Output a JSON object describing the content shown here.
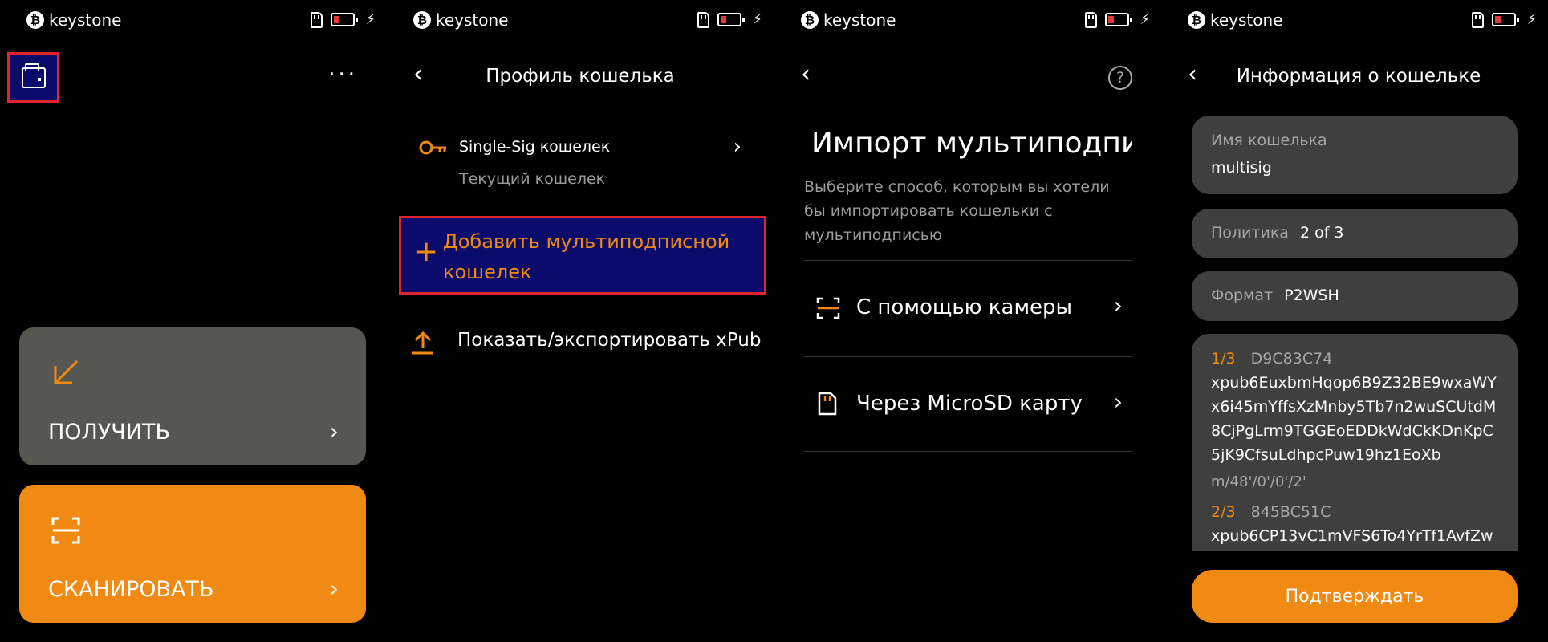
{
  "status_bar": {
    "brand": "keystone",
    "btc_symbol": "₿"
  },
  "screen1": {
    "receive_label": "ПОЛУЧИТЬ",
    "scan_label": "СКАНИРОВАТЬ",
    "chevron": "›",
    "more": "···",
    "colors": {
      "receive_card": "#565752",
      "scan_card": "#f18a12"
    }
  },
  "screen2": {
    "title": "Профиль кошелька",
    "single_sig_title": "Single-Sig кошелек",
    "single_sig_sub": "Текущий кошелек",
    "add_multisig": "Добавить мультиподписной кошелек",
    "plus": "+",
    "export_xpub": "Показать/экспортировать xPub"
  },
  "screen3": {
    "title": "Импорт мультиподпис",
    "description": "Выберите способ, которым вы хотели бы импортировать кошельки с мультиподписью",
    "help": "?",
    "options": [
      {
        "label": "С помощью камеры",
        "icon": "scan-icon"
      },
      {
        "label": "Через MicroSD карту",
        "icon": "microsd-icon"
      }
    ]
  },
  "screen4": {
    "title": "Информация о кошельке",
    "name_label": "Имя кошелька",
    "name_value": "multisig",
    "policy_label": "Политика",
    "policy_value": "2 of 3",
    "format_label": "Формат",
    "format_value": "P2WSH",
    "keys": [
      {
        "index": "1/3",
        "fingerprint": "D9C83C74",
        "xpub": "xpub6EuxbmHqop6B9Z32BE9wxaWYx6i45mYffsXzMnby5Tb7n2wuSCUtdM8CjPgLrm9TGGEoEDDkWdCkKDnKpC5jK9CfsuLdhpcPuw19hz1EoXb",
        "path": "m/48'/0'/0'/2'"
      },
      {
        "index": "2/3",
        "fingerprint": "845BC51C",
        "xpub": "xpub6CP13vC1mVFS6To4YrTf1AvfZw",
        "path": ""
      }
    ],
    "confirm": "Подтверждать"
  },
  "back": "‹",
  "accent": "#f18a12",
  "highlight": "#e0232d"
}
